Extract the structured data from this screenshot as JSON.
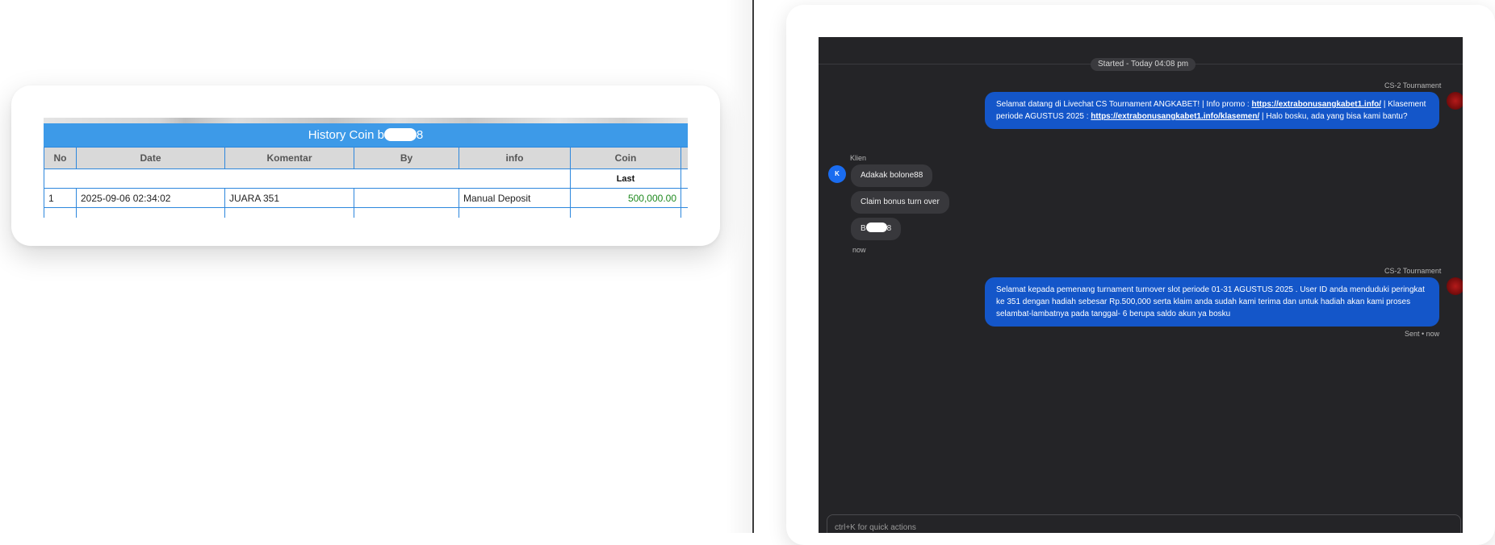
{
  "history": {
    "title_prefix": "History Coin b",
    "title_suffix": "8",
    "headers": [
      "No",
      "Date",
      "Komentar",
      "By",
      "info",
      "Coin"
    ],
    "last_label": "Last",
    "rows": [
      {
        "no": "1",
        "date": "2025-09-06 02:34:02",
        "komentar": "JUARA 351",
        "by": "",
        "info": "Manual Deposit",
        "coin": "500,000.00"
      }
    ],
    "coin_color": "#1f8a1f",
    "header_color": "#3d9ae8"
  },
  "chat": {
    "started": "Started - Today 04:08 pm",
    "agent_name": "CS-2 Tournament",
    "client_label": "Klien",
    "client_initial": "K",
    "msg1": {
      "t1": "Selamat datang di Livechat CS Tournament ANGKABET! | Info promo : ",
      "link1": "https://extrabonusangkabet1.info/",
      "t2": " | Klasement periode AGUSTUS 2025 : ",
      "link2": "https://extrabonusangkabet1.info/klasemen/",
      "t3": " | Halo bosku, ada yang bisa kami bantu?"
    },
    "client_msgs": [
      "Adakak bolone88",
      "Claim bonus turn over"
    ],
    "client_masked_prefix": "B",
    "client_masked_suffix": "8",
    "client_time": "now",
    "msg2": "Selamat kepada pemenang turnament turnover slot periode 01-31 AGUSTUS 2025 . User ID anda menduduki peringkat ke 351 dengan hadiah sebesar Rp.500,000 serta klaim anda sudah kami terima dan untuk hadiah akan kami proses selambat-lambatnya pada tanggal- 6 berupa saldo akun ya bosku",
    "sent_status": "Sent • now",
    "composer_placeholder": "ctrl+K for quick actions",
    "bubble_color": "#1456c9",
    "background_color": "#242427"
  }
}
